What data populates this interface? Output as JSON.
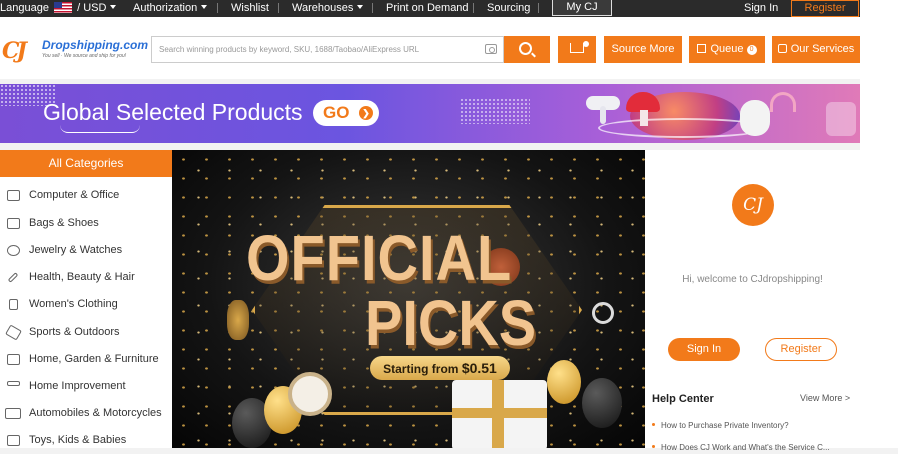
{
  "topbar": {
    "language_label": "Language",
    "currency": "/ USD",
    "authorization": "Authorization",
    "wishlist": "Wishlist",
    "warehouses": "Warehouses",
    "print_on_demand": "Print on Demand",
    "sourcing": "Sourcing",
    "my_cj": "My CJ",
    "sign_in": "Sign In",
    "register": "Register"
  },
  "header": {
    "logo_mark": "CJ",
    "logo_name": "Dropshipping.com",
    "logo_tagline": "You sell · We source and ship for you!",
    "search_placeholder": "Search winning products by keyword, SKU, 1688/Taobao/AliExpress URL",
    "source_more": "Source More",
    "queue": "Queue",
    "queue_count": "0",
    "our_services": "Our Services"
  },
  "banner": {
    "title": "Global Selected Products",
    "go": "GO"
  },
  "sidebar": {
    "header": "All Categories",
    "categories": [
      {
        "label": "Computer & Office",
        "icon": "monitor-icon"
      },
      {
        "label": "Bags & Shoes",
        "icon": "bag-icon"
      },
      {
        "label": "Jewelry & Watches",
        "icon": "watch-icon"
      },
      {
        "label": "Health, Beauty & Hair",
        "icon": "brush-icon"
      },
      {
        "label": "Women's Clothing",
        "icon": "dress-icon"
      },
      {
        "label": "Sports & Outdoors",
        "icon": "sports-icon"
      },
      {
        "label": "Home, Garden & Furniture",
        "icon": "home-icon"
      },
      {
        "label": "Home Improvement",
        "icon": "tool-icon"
      },
      {
        "label": "Automobiles & Motorcycles",
        "icon": "car-icon"
      },
      {
        "label": "Toys, Kids & Babies",
        "icon": "toy-icon"
      }
    ]
  },
  "hero": {
    "line1": "OFFICIAL",
    "line2": "PICKS",
    "starting_from": "Starting from",
    "price": "$0.51"
  },
  "account": {
    "avatar_text": "CJ",
    "welcome": "Hi, welcome to CJdropshipping!",
    "sign_in": "Sign In",
    "register": "Register"
  },
  "help": {
    "title": "Help Center",
    "view_more": "View More  >",
    "items": [
      "How to Purchase Private Inventory?",
      "How Does CJ Work and What's the Service C..."
    ]
  },
  "colors": {
    "accent": "#f27a1a",
    "topbar": "#2b2b2b"
  }
}
